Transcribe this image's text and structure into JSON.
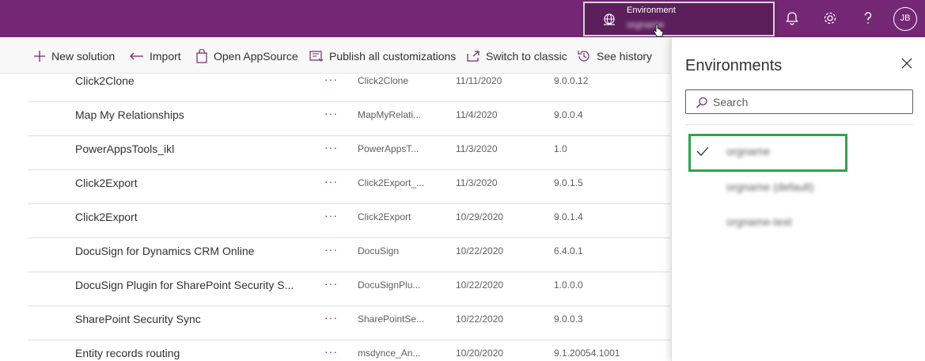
{
  "header": {
    "environment_label": "Environment",
    "environment_value": "orgname",
    "avatar_initials": "JB",
    "icons": [
      "globe-icon",
      "bell-icon",
      "gear-icon",
      "help-icon"
    ]
  },
  "commands": [
    {
      "label": "New solution",
      "icon": "plus-icon"
    },
    {
      "label": "Import",
      "icon": "import-icon"
    },
    {
      "label": "Open AppSource",
      "icon": "shopping-bag-icon"
    },
    {
      "label": "Publish all customizations",
      "icon": "publish-icon"
    },
    {
      "label": "Switch to classic",
      "icon": "external-link-icon"
    },
    {
      "label": "See history",
      "icon": "history-icon"
    }
  ],
  "solutions": [
    {
      "name": "Click2Clone",
      "more": "···",
      "unique": "Click2Clone",
      "date": "11/11/2020",
      "version": "9.0.0.12"
    },
    {
      "name": "Map My Relationships",
      "more": "···",
      "unique": "MapMyRelati...",
      "date": "11/4/2020",
      "version": "9.0.0.4"
    },
    {
      "name": "PowerAppsTools_ikl",
      "more": "···",
      "unique": "PowerAppsT...",
      "date": "11/3/2020",
      "version": "1.0"
    },
    {
      "name": "Click2Export",
      "more": "···",
      "unique": "Click2Export_...",
      "date": "11/3/2020",
      "version": "9.0.1.5"
    },
    {
      "name": "Click2Export",
      "more": "···",
      "unique": "Click2Export",
      "date": "10/29/2020",
      "version": "9.0.1.4"
    },
    {
      "name": "DocuSign for Dynamics CRM Online",
      "more": "···",
      "unique": "DocuSign",
      "date": "10/22/2020",
      "version": "6.4.0.1"
    },
    {
      "name": "DocuSign Plugin for SharePoint Security S...",
      "more": "···",
      "unique": "DocuSignPlu...",
      "date": "10/22/2020",
      "version": "1.0.0.0"
    },
    {
      "name": "SharePoint Security Sync",
      "more": "···",
      "unique": "SharePointSe...",
      "date": "10/22/2020",
      "version": "9.0.0.3"
    },
    {
      "name": "Entity records routing",
      "more": "···",
      "unique": "msdynce_An...",
      "date": "10/20/2020",
      "version": "9.1.20054.1001"
    }
  ],
  "panel": {
    "title": "Environments",
    "search_placeholder": "Search",
    "environments": [
      {
        "name": "orgname",
        "selected": true
      },
      {
        "name": "orgname (default)",
        "selected": false
      },
      {
        "name": "orgname-test",
        "selected": false
      }
    ]
  },
  "colors": {
    "header": "#742774",
    "selection_highlight": "#2ea44f"
  }
}
